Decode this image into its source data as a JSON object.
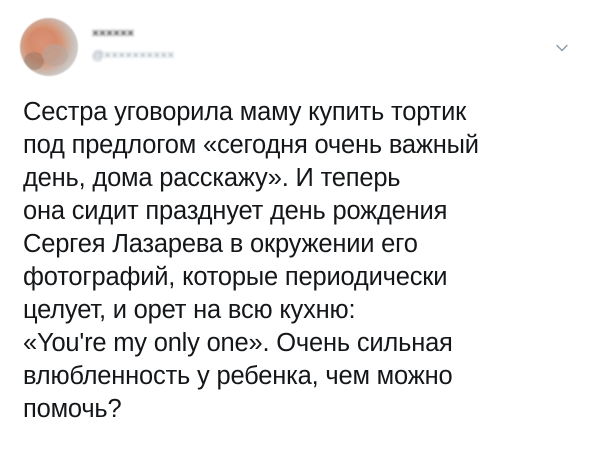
{
  "tweet": {
    "author": {
      "display_name": "××××××",
      "handle": "@××××××××××"
    },
    "menu_icon": "chevron-down-icon",
    "text_lines": [
      "Сестра уговорила маму купить тортик",
      "под предлогом «сегодня очень важный",
      "день, дома расскажу». И теперь",
      "она сидит празднует день рождения",
      "Сергея Лазарева в окружении его",
      "фотографий, которые периодически",
      "целует, и орет на всю кухню:",
      "«You're my only one». Очень сильная",
      "влюбленность у ребенка, чем можно",
      "помочь?"
    ]
  },
  "colors": {
    "text": "#14171a",
    "secondary": "#8899a6",
    "background": "#ffffff"
  }
}
